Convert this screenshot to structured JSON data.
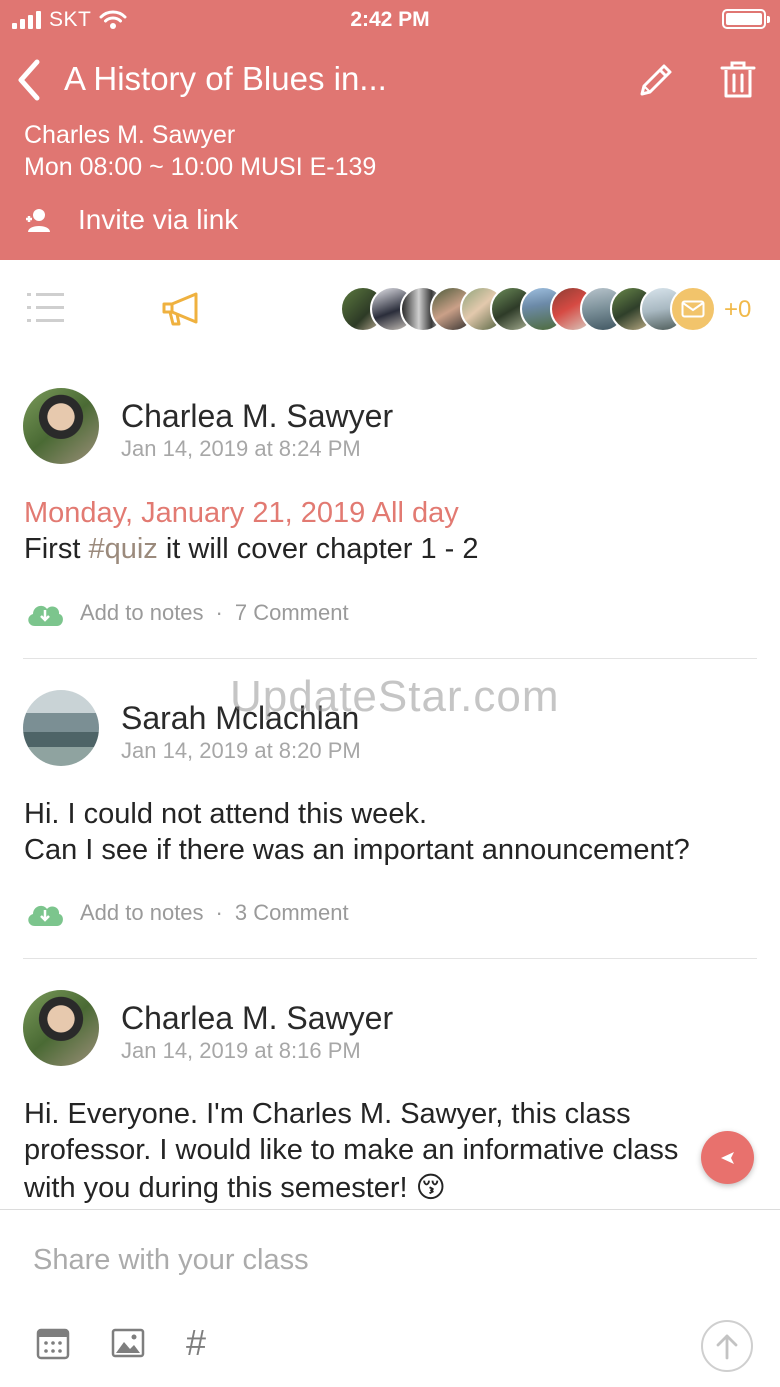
{
  "status_bar": {
    "carrier": "SKT",
    "time": "2:42 PM"
  },
  "header": {
    "title": "A History of Blues in...",
    "professor": "Charles M. Sawyer",
    "schedule": "Mon 08:00 ~ 10:00 MUSI E-139",
    "invite_label": "Invite via link"
  },
  "members": {
    "extra_count": "+0"
  },
  "posts": [
    {
      "author": "Charlea M. Sawyer",
      "timestamp": "Jan 14, 2019 at 8:24 PM",
      "event_date": "Monday, January 21, 2019 All day",
      "body": {
        "before": "First ",
        "hashtag": "#quiz",
        "after": " it will cover chapter 1 - 2"
      },
      "add_notes": "Add to notes",
      "separator": "·",
      "comments": "7 Comment"
    },
    {
      "author": "Sarah Mclachlan",
      "timestamp": "Jan 14, 2019 at 8:20 PM",
      "lines": [
        "Hi. I could not attend this week.",
        "Can I see if there was an important announcement?"
      ],
      "add_notes": "Add to notes",
      "separator": "·",
      "comments": "3 Comment"
    },
    {
      "author": "Charlea M. Sawyer",
      "timestamp": "Jan 14, 2019 at 8:16 PM",
      "lines": [
        "Hi. Everyone. I'm Charles M. Sawyer, this class",
        "professor. I would like to make an informative class",
        "with you during this semester! 😚"
      ]
    }
  ],
  "watermark": "UpdateStar.com",
  "composer": {
    "placeholder": "Share with your class",
    "hash_symbol": "#"
  },
  "colors": {
    "brand": "#e07672",
    "accent": "#f1b94a",
    "event_date": "#e27a72",
    "cloud": "#7cc58d"
  }
}
